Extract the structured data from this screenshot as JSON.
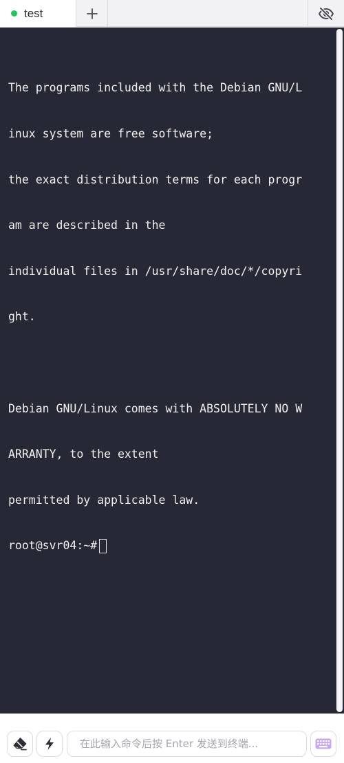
{
  "tabs": [
    {
      "label": "test",
      "status_color": "#22c55e",
      "active": true
    }
  ],
  "tabbar": {
    "add_icon": "plus-icon",
    "visibility_icon": "eye-off-icon"
  },
  "terminal": {
    "lines": [
      "The programs included with the Debian GNU/L",
      "inux system are free software;",
      "the exact distribution terms for each progr",
      "am are described in the",
      "individual files in /usr/share/doc/*/copyri",
      "ght.",
      "",
      "Debian GNU/Linux comes with ABSOLUTELY NO W",
      "ARRANTY, to the extent",
      "permitted by applicable law."
    ],
    "prompt": "root@svr04:~#",
    "background": "#262935",
    "foreground": "#f1f1f1"
  },
  "bottombar": {
    "clear_icon": "eraser-icon",
    "quick_icon": "lightning-icon",
    "input_value": "",
    "input_placeholder": "在此输入命令后按 Enter 发送到终端...",
    "keyboard_icon": "keyboard-icon",
    "keyboard_color": "#c9a6ef"
  }
}
